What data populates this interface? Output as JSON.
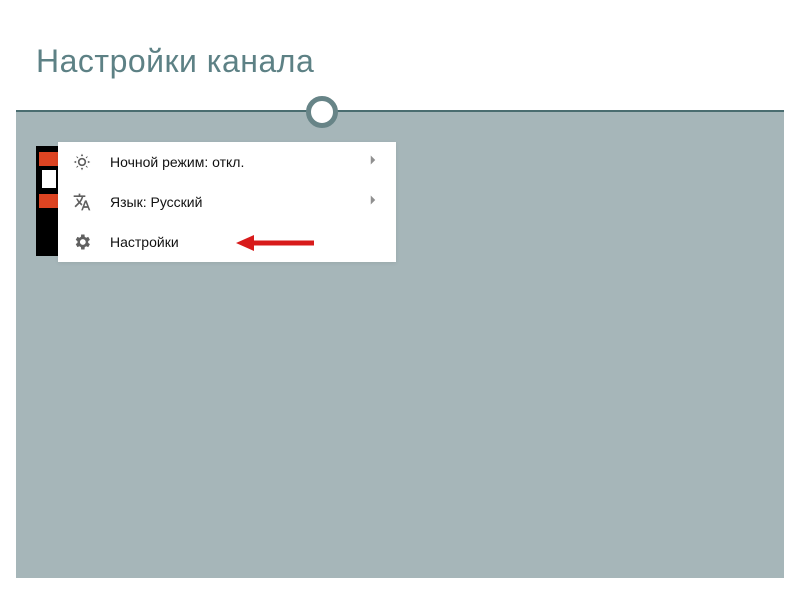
{
  "header": {
    "title": "Настройки канала"
  },
  "menu": {
    "items": [
      {
        "icon": "brightness-icon",
        "label": "Ночной режим: откл.",
        "has_chevron": true
      },
      {
        "icon": "translate-icon",
        "label": "Язык: Русский",
        "has_chevron": true
      },
      {
        "icon": "gear-icon",
        "label": "Настройки",
        "has_chevron": false
      }
    ]
  }
}
